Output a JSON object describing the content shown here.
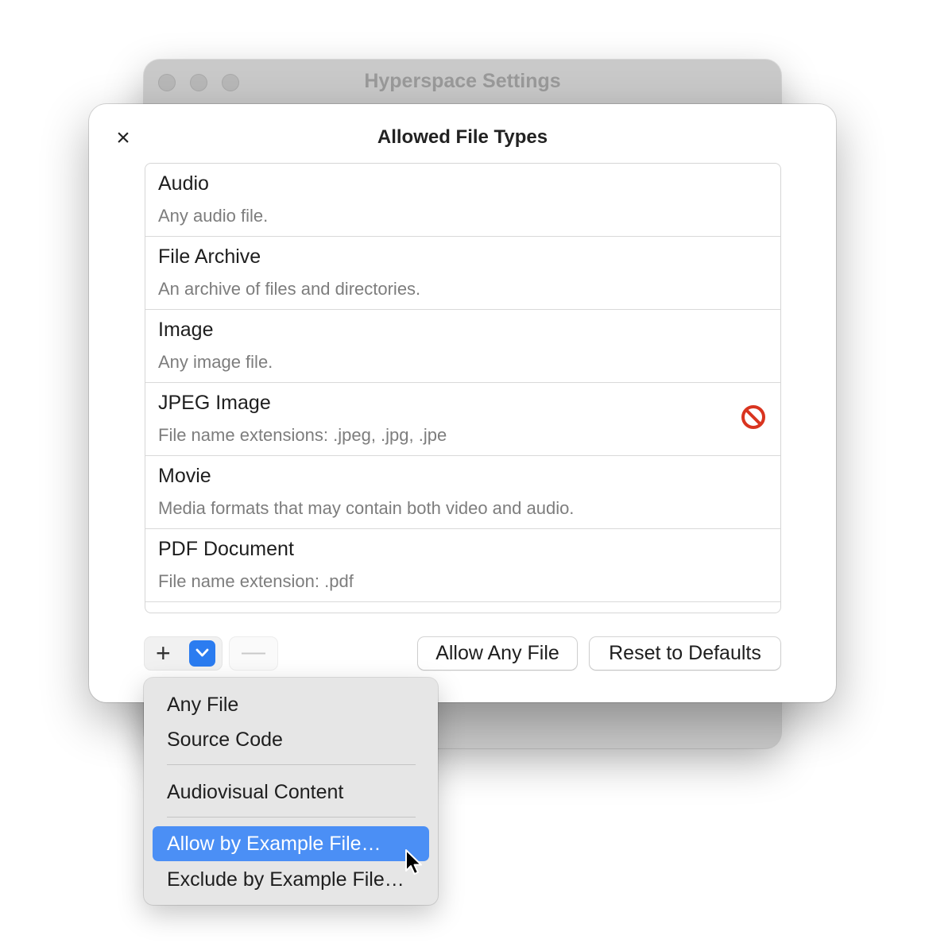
{
  "background_window": {
    "title": "Hyperspace Settings"
  },
  "sheet": {
    "title": "Allowed File Types",
    "close_icon": "×"
  },
  "file_types": [
    {
      "title": "Audio",
      "subtitle": "Any audio file."
    },
    {
      "title": "File Archive",
      "subtitle": "An archive of files and directories."
    },
    {
      "title": "Image",
      "subtitle": "Any image file."
    },
    {
      "title": "JPEG Image",
      "subtitle": "File name extensions: .jpeg, .jpg, .jpe",
      "excluded": true
    },
    {
      "title": "Movie",
      "subtitle": "Media formats that may contain both video and audio."
    },
    {
      "title": "PDF Document",
      "subtitle": "File name extension: .pdf"
    }
  ],
  "toolbar": {
    "add_label": "+",
    "remove_label": "—",
    "allow_any_label": "Allow Any File",
    "reset_label": "Reset to Defaults"
  },
  "add_menu": {
    "items": [
      {
        "label": "Any File"
      },
      {
        "label": "Source Code"
      },
      {
        "label": "Audiovisual Content"
      },
      {
        "label": "Allow by Example File…",
        "highlighted": true
      },
      {
        "label": "Exclude by Example File…"
      }
    ]
  },
  "colors": {
    "accent": "#2b7cf0",
    "menu_highlight": "#4b8ff5",
    "prohibit_red": "#d9341f"
  }
}
